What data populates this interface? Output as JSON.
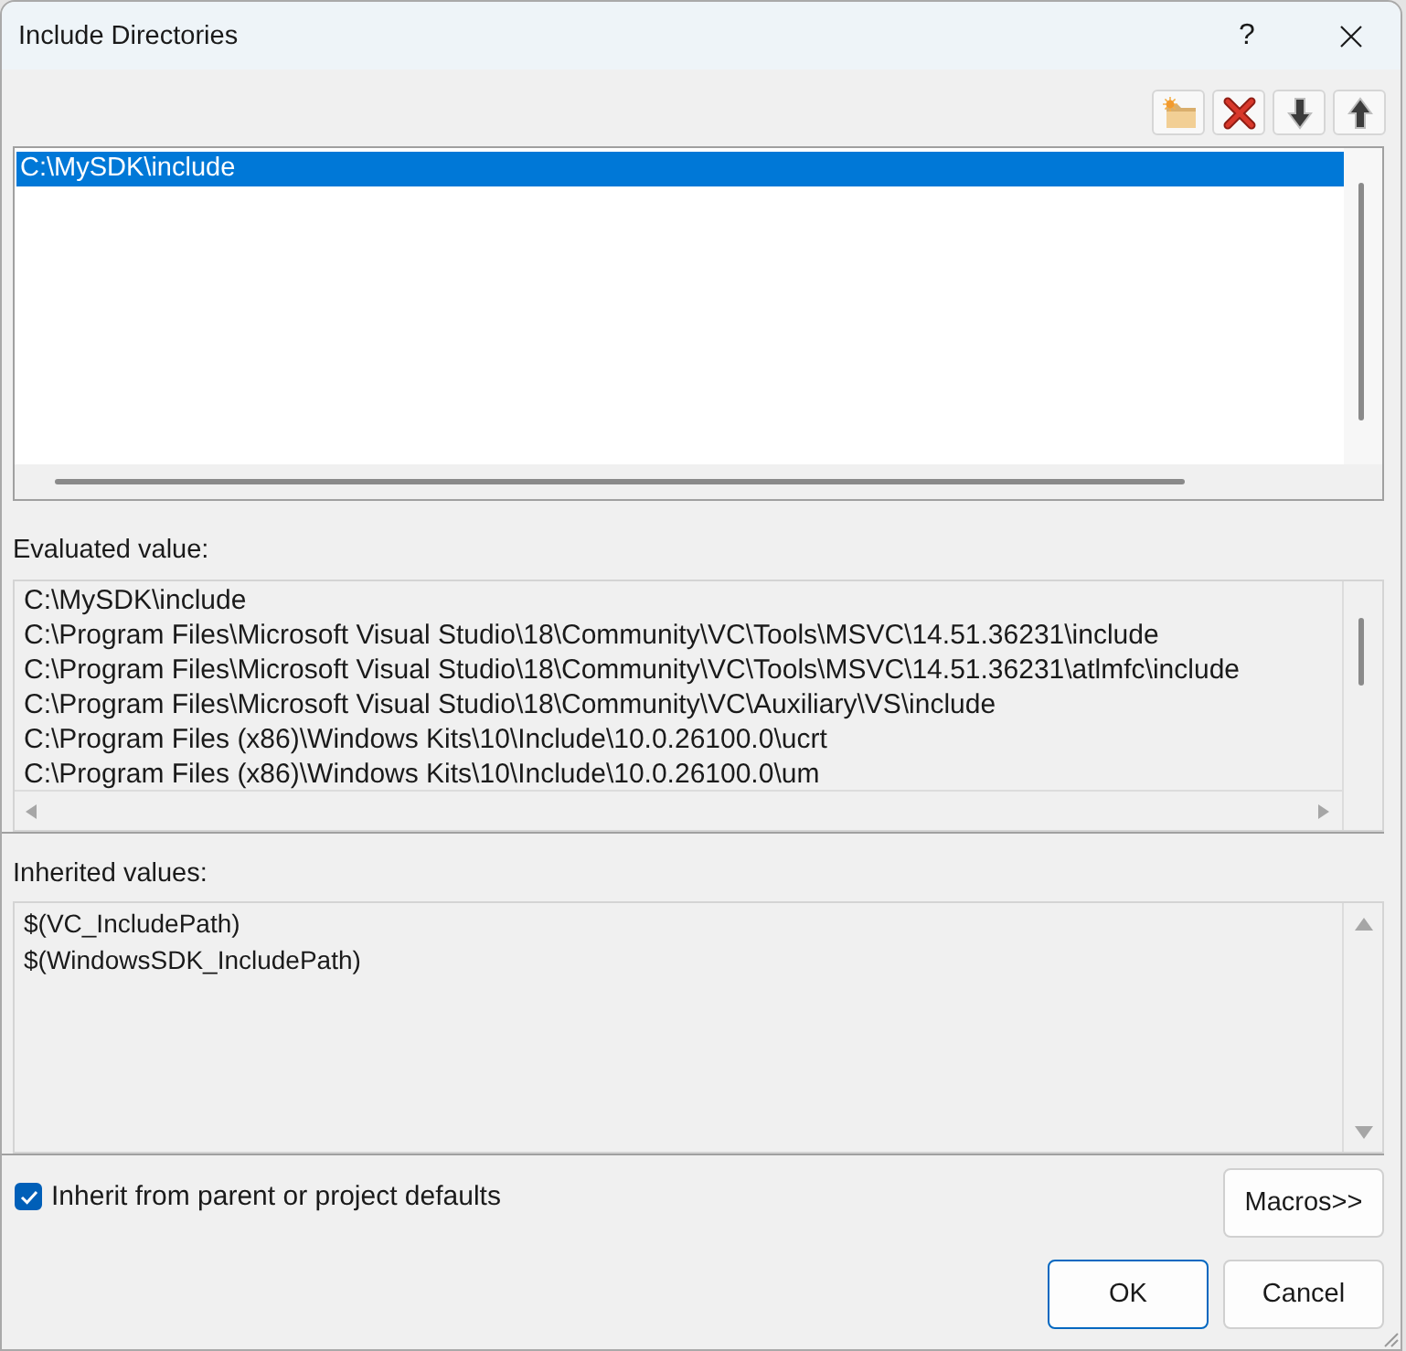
{
  "window": {
    "title": "Include Directories",
    "help_label": "?"
  },
  "directories": {
    "items": [
      {
        "text": "C:\\MySDK\\include",
        "selected": true
      }
    ]
  },
  "evaluated": {
    "label": "Evaluated value:",
    "lines": [
      "C:\\MySDK\\include",
      "C:\\Program Files\\Microsoft Visual Studio\\18\\Community\\VC\\Tools\\MSVC\\14.51.36231\\include",
      "C:\\Program Files\\Microsoft Visual Studio\\18\\Community\\VC\\Tools\\MSVC\\14.51.36231\\atlmfc\\include",
      "C:\\Program Files\\Microsoft Visual Studio\\18\\Community\\VC\\Auxiliary\\VS\\include",
      "C:\\Program Files (x86)\\Windows Kits\\10\\Include\\10.0.26100.0\\ucrt",
      "C:\\Program Files (x86)\\Windows Kits\\10\\Include\\10.0.26100.0\\um"
    ]
  },
  "inherited": {
    "label": "Inherited values:",
    "lines": [
      "$(VC_IncludePath)",
      "$(WindowsSDK_IncludePath)"
    ]
  },
  "inherit": {
    "label": "Inherit from parent or project defaults",
    "checked": true
  },
  "buttons": [
    {
      "label": "Macros>>",
      "kind": "normal"
    },
    {
      "label": "OK",
      "kind": "default"
    },
    {
      "label": "Cancel",
      "kind": "normal"
    }
  ]
}
